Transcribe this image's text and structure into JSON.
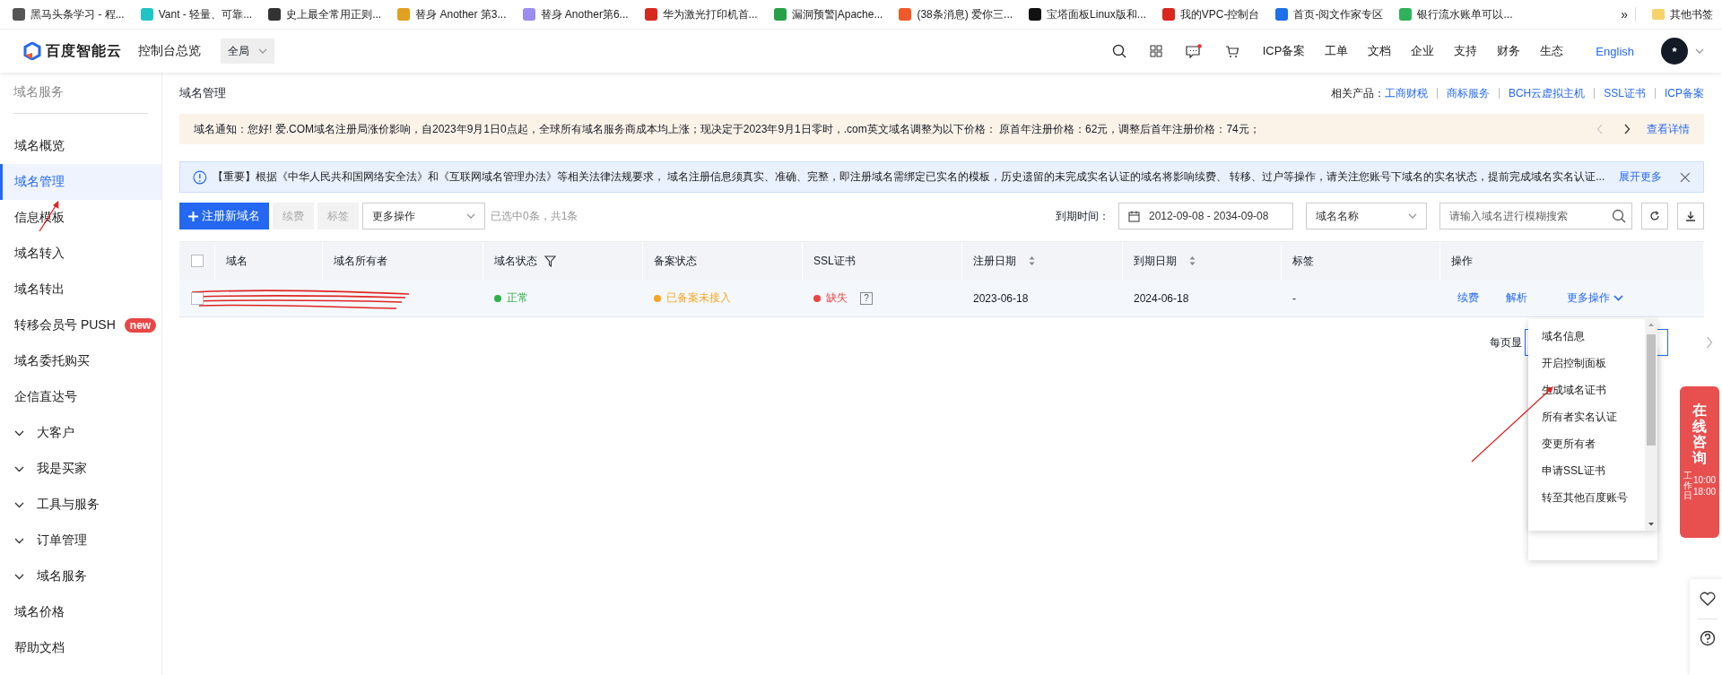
{
  "bookmarks": [
    {
      "label": "黑马头条学习 - 程...",
      "color": "#555555"
    },
    {
      "label": "Vant - 轻量、可靠...",
      "color": "#1fc5c5"
    },
    {
      "label": "史上最全常用正则...",
      "color": "#333333"
    },
    {
      "label": "替身 Another 第3...",
      "color": "#e0a020"
    },
    {
      "label": "替身 Another第6...",
      "color": "#9b8cf0"
    },
    {
      "label": "华为激光打印机首...",
      "color": "#d9281e"
    },
    {
      "label": "漏洞预警|Apache...",
      "color": "#27a04a"
    },
    {
      "label": "(38条消息) 爱你三...",
      "color": "#f05a28"
    },
    {
      "label": "宝塔面板Linux版和...",
      "color": "#111111"
    },
    {
      "label": "我的VPC-控制台",
      "color": "#d9281e"
    },
    {
      "label": "首页-阅文作家专区",
      "color": "#1e6fe8"
    },
    {
      "label": "银行流水账单可以...",
      "color": "#2fb35a"
    }
  ],
  "bookmarks_more": "»",
  "other_bookmarks": "其他书签",
  "header": {
    "logo": "百度智能云",
    "overview": "控制台总览",
    "scope": "全局",
    "nav": [
      "ICP备案",
      "工单",
      "文档",
      "企业",
      "支持",
      "财务",
      "生态"
    ],
    "language": "English",
    "avatar": "*",
    "messages_unread": true
  },
  "sidebar": {
    "title": "域名服务",
    "items": [
      {
        "label": "域名概览",
        "selected": false,
        "kind": "link"
      },
      {
        "label": "域名管理",
        "selected": true,
        "kind": "link"
      },
      {
        "label": "信息模板",
        "selected": false,
        "kind": "link"
      },
      {
        "label": "域名转入",
        "selected": false,
        "kind": "link"
      },
      {
        "label": "域名转出",
        "selected": false,
        "kind": "link"
      },
      {
        "label": "转移会员号 PUSH",
        "selected": false,
        "kind": "link",
        "badge": "new"
      },
      {
        "label": "域名委托购买",
        "selected": false,
        "kind": "link"
      },
      {
        "label": "企信直达号",
        "selected": false,
        "kind": "link"
      },
      {
        "label": "大客户",
        "selected": false,
        "kind": "group"
      },
      {
        "label": "我是买家",
        "selected": false,
        "kind": "group"
      },
      {
        "label": "工具与服务",
        "selected": false,
        "kind": "group"
      },
      {
        "label": "订单管理",
        "selected": false,
        "kind": "group"
      },
      {
        "label": "域名服务",
        "selected": false,
        "kind": "group"
      },
      {
        "label": "域名价格",
        "selected": false,
        "kind": "link"
      },
      {
        "label": "帮助文档",
        "selected": false,
        "kind": "link"
      }
    ]
  },
  "page": {
    "title": "域名管理",
    "related_label": "相关产品：",
    "related": [
      "工商财税",
      "商标服务",
      "BCH云虚拟主机",
      "SSL证书",
      "ICP备案"
    ]
  },
  "notice": {
    "text": "域名通知：您好! 爱.COM域名注册局涨价影响，自2023年9月1日0点起，全球所有域名服务商成本均上涨；现决定于2023年9月1日零时，.com英文域名调整为以下价格： 原首年注册价格：62元，调整后首年注册价格：74元；",
    "link": "查看详情"
  },
  "important": {
    "text": "【重要】根据《中华人民共和国网络安全法》和《互联网域名管理办法》等相关法律法规要求， 域名注册信息须真实、准确、完整，即注册域名需绑定已实名的模板，历史遗留的未完成实名认证的域名将影响续费、 转移、过户等操作，请关注您账号下域名的实名状态，提前完成域名实名认证...",
    "link": "展开更多"
  },
  "toolbar": {
    "buttons": [
      {
        "label": "注册新域名",
        "kind": "primary",
        "disabled": false
      },
      {
        "label": "续费",
        "kind": "plain",
        "disabled": true
      },
      {
        "label": "标签",
        "kind": "plain",
        "disabled": true
      }
    ],
    "more_select": "更多操作",
    "selection": "已选中0条，共1条",
    "date_label": "到期时间：",
    "date_range": "2012-09-08 - 2034-09-08",
    "filter_select": "域名名称",
    "search_placeholder": "请输入域名进行模糊搜索"
  },
  "table": {
    "header_checked": false,
    "columns": [
      {
        "label": "域名",
        "sortable": false,
        "filter": false
      },
      {
        "label": "域名所有者",
        "sortable": false,
        "filter": false
      },
      {
        "label": "域名状态",
        "sortable": false,
        "filter": true
      },
      {
        "label": "备案状态",
        "sortable": false,
        "filter": false
      },
      {
        "label": "SSL证书",
        "sortable": false,
        "filter": false
      },
      {
        "label": "注册日期",
        "sortable": true,
        "filter": false
      },
      {
        "label": "到期日期",
        "sortable": true,
        "filter": false
      },
      {
        "label": "标签",
        "sortable": false,
        "filter": false
      },
      {
        "label": "操作",
        "sortable": false,
        "filter": false
      }
    ],
    "rows": [
      {
        "checked": false,
        "redacted": true,
        "status": {
          "text": "正常",
          "color": "#30b04a"
        },
        "record": {
          "text": "已备案未接入",
          "color": "#f5a623"
        },
        "ssl": {
          "text": "缺失",
          "color": "#e84747",
          "help": "?"
        },
        "registered": "2023-06-18",
        "expires": "2024-06-18",
        "tag": "-",
        "actions": [
          "续费",
          "解析"
        ],
        "more": "更多操作"
      }
    ]
  },
  "pagination": {
    "label": "每页显"
  },
  "more_menu": [
    "域名信息",
    "开启控制面板",
    "生成域名证书",
    "所有者实名认证",
    "变更所有者",
    "申请SSL证书",
    "转至其他百度账号"
  ],
  "consult": {
    "title": "在线咨询",
    "days": "工作日",
    "open": "10:00",
    "close": "18:00"
  }
}
